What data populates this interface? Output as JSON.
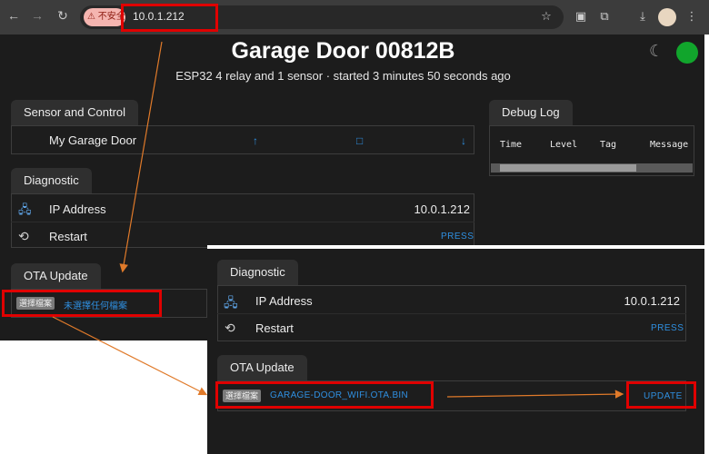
{
  "browser": {
    "url": "10.0.1.212",
    "security_label": "不安全",
    "icons": [
      "back-icon",
      "forward-icon",
      "reload-icon",
      "warning-icon",
      "bookmark-star-icon",
      "extension-icon",
      "puzzle-icon",
      "download-icon",
      "avatar",
      "menu-icon"
    ]
  },
  "page": {
    "title": "Garage Door 00812B",
    "subtitle": "ESP32 4 relay and 1 sensor · started 3 minutes 50 seconds ago",
    "status_color": "#11a52c"
  },
  "sensor_control": {
    "tab": "Sensor and Control",
    "device": "My Garage Door",
    "up_symbol": "↑",
    "stop_symbol": "□",
    "down_symbol": "↓"
  },
  "debug_log": {
    "tab": "Debug Log",
    "columns": [
      "Time",
      "Level",
      "Tag",
      "Message"
    ]
  },
  "diagnostic": {
    "tab": "Diagnostic",
    "ip_label": "IP Address",
    "ip_value": "10.0.1.212",
    "restart_label": "Restart",
    "press_label": "PRESS"
  },
  "ota": {
    "tab": "OTA Update",
    "choose_file_label": "選擇檔案",
    "no_file_text": "未選擇任何檔案",
    "selected_file": "GARAGE-DOOR_WIFI.OTA.BIN",
    "update_label": "UPDATE"
  },
  "annotation_colors": {
    "highlight": "#e00000",
    "arrow": "#e07a2a"
  }
}
